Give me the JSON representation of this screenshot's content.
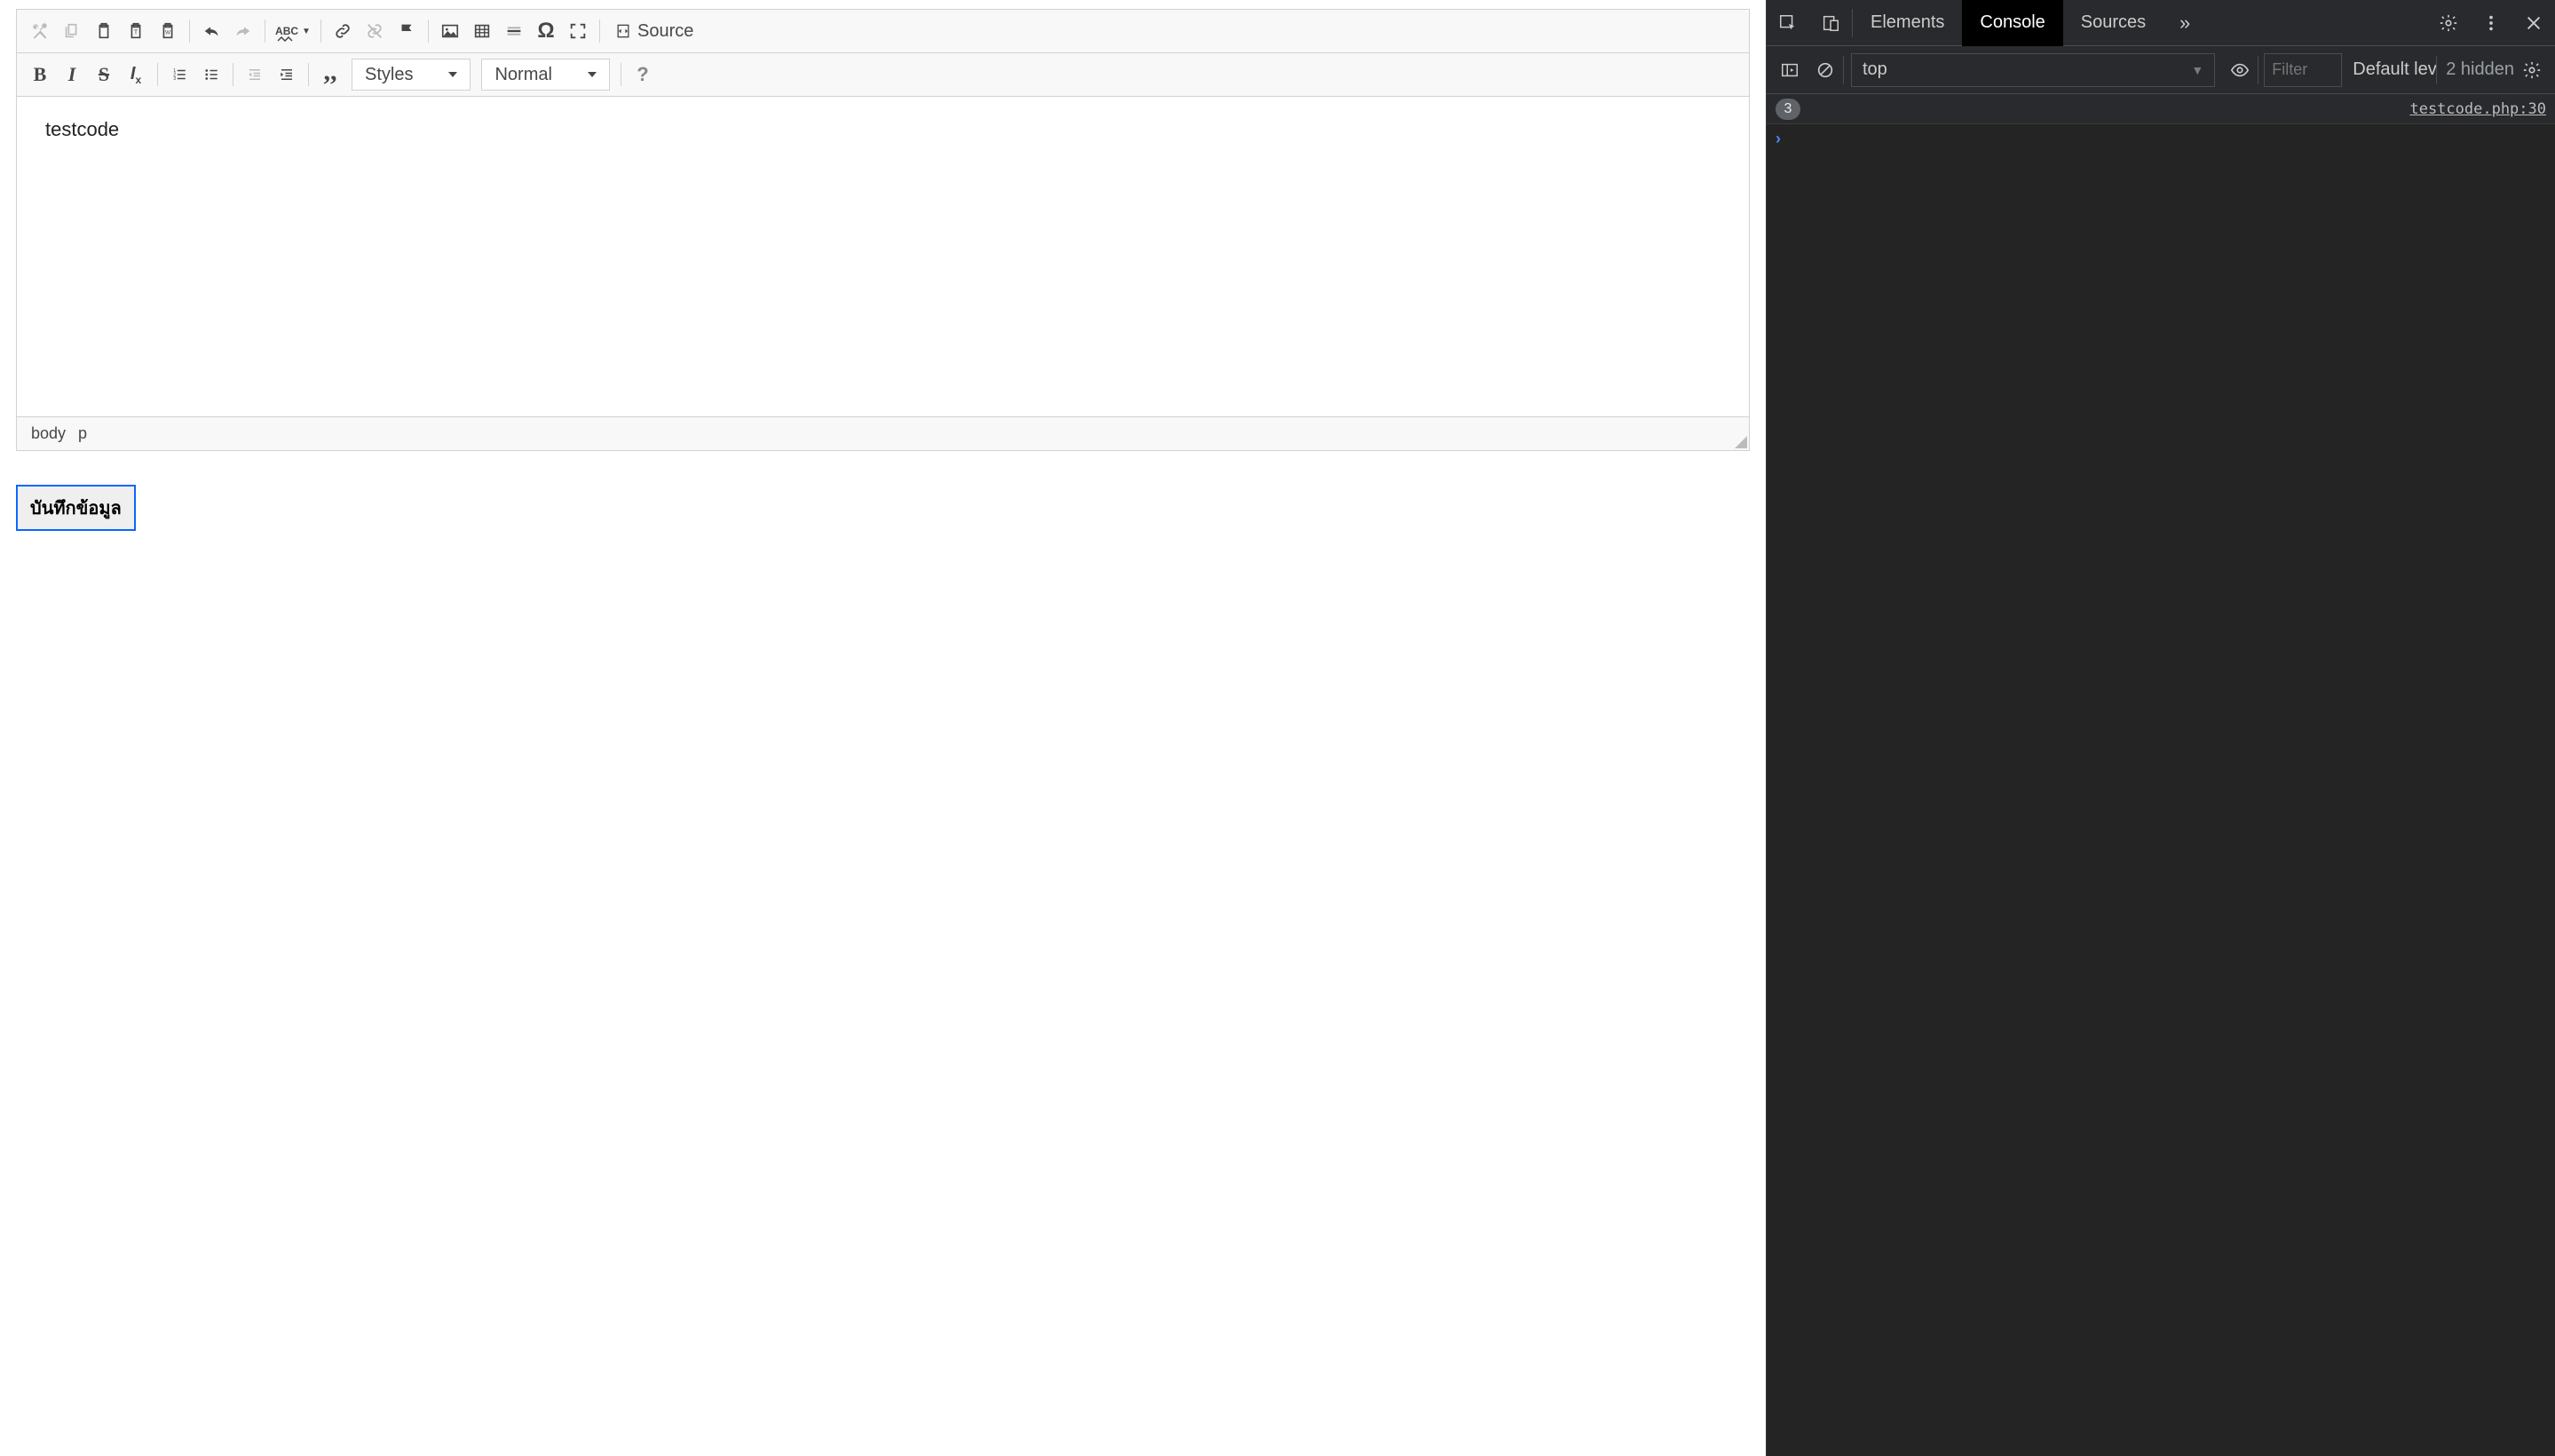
{
  "editor": {
    "source_label": "Source",
    "styles_label": "Styles",
    "format_label": "Normal",
    "content": "testcode",
    "path": {
      "body": "body",
      "p": "p"
    },
    "spellcheck_label": "ABC"
  },
  "submit_button_label": "บันทึกข้อมูล",
  "devtools": {
    "tabs": {
      "elements": "Elements",
      "console": "Console",
      "sources": "Sources"
    },
    "context_label": "top",
    "filter_placeholder": "Filter",
    "levels_label": "Default levels",
    "hidden_label": "2 hidden",
    "message_count": "3",
    "message_source": "testcode.php:30"
  }
}
